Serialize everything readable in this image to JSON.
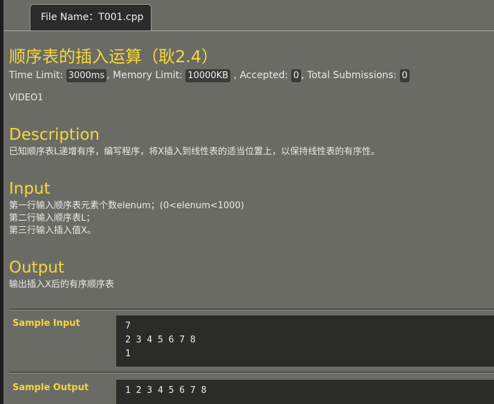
{
  "tab": {
    "file_name": "File Name：T001.cpp"
  },
  "problem": {
    "title": "顺序表的插入运算（耿2.4）",
    "meta": {
      "time_limit_label": "Time Limit:",
      "time_limit_value": "3000ms",
      "memory_limit_label": ", Memory Limit:",
      "memory_limit_value": "10000KB",
      "accepted_label": ", Accepted:",
      "accepted_value": "0",
      "total_label": ", Total Submissions:",
      "total_value": "0"
    },
    "video_label": "VIDEO1",
    "description": {
      "heading": "Description",
      "text": "已知顺序表L递增有序，编写程序，将X插入到线性表的适当位置上，以保持线性表的有序性。"
    },
    "input": {
      "heading": "Input",
      "lines": [
        "第一行输入顺序表元素个数elenum；(0<elenum<1000)",
        "第二行输入顺序表L；",
        "第三行输入插入值X。"
      ]
    },
    "output": {
      "heading": "Output",
      "text": "输出插入X后的有序顺序表"
    },
    "sample_input": {
      "label": "Sample Input",
      "lines": [
        "7",
        "2 3 4 5 6 7 8",
        "1"
      ]
    },
    "sample_output": {
      "label": "Sample Output",
      "lines": [
        "1 2 3 4 5 6 7 8"
      ]
    }
  }
}
